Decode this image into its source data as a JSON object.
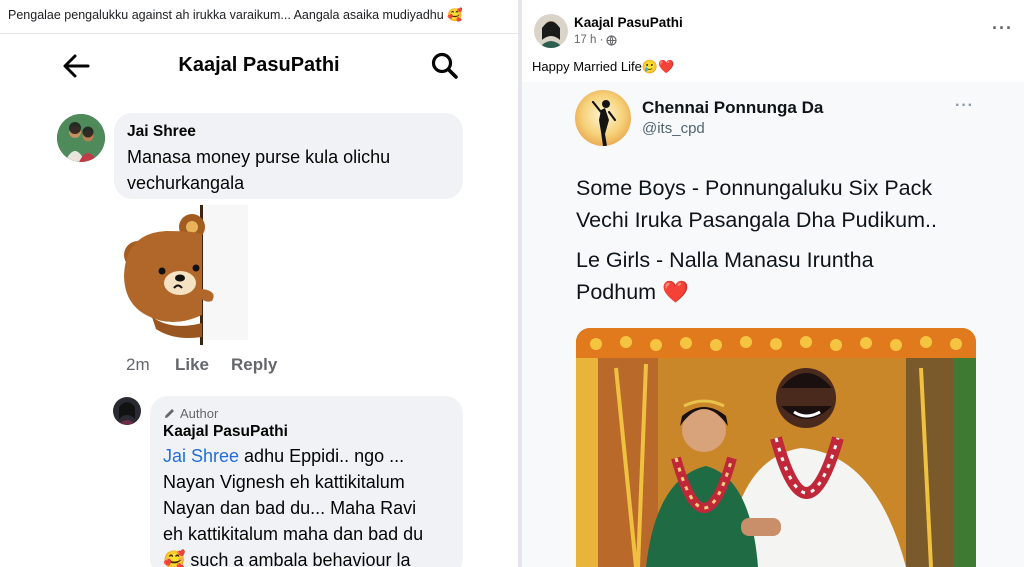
{
  "left": {
    "caption": "Pengalae pengalukku against ah irukka varaikum...  Aangala asaika mudiyadhu 🥰",
    "header_title": "Kaajal PasuPathi",
    "comment1": {
      "name": "Jai Shree",
      "text": "Manasa money purse kula olichu vechurkangala",
      "time": "2m",
      "like": "Like",
      "reply": "Reply"
    },
    "reply": {
      "author_tag": "Author",
      "name": "Kaajal PasuPathi",
      "mention": "Jai Shree",
      "line1": " adhu Eppidi.. ngo ...",
      "line2": "Nayan Vignesh eh kattikitalum",
      "line3": "Nayan dan bad du...  Maha Ravi",
      "line4": "eh kattikitalum maha dan bad du",
      "line5": "🥰 such a ambala behaviour la"
    }
  },
  "right": {
    "poster_name": "Kaajal PasuPathi",
    "time": "17 h ·",
    "caption": "Happy Married Life🥲❤️",
    "tweet": {
      "name": "Chennai Ponnunga Da",
      "handle": "@its_cpd",
      "line1": "Some Boys - Ponnungaluku Six Pack",
      "line2": "Vechi Iruka Pasangala Dha Pudikum..",
      "line3": "Le Girls - Nalla Manasu Iruntha",
      "line4": "Podhum ❤️"
    }
  }
}
